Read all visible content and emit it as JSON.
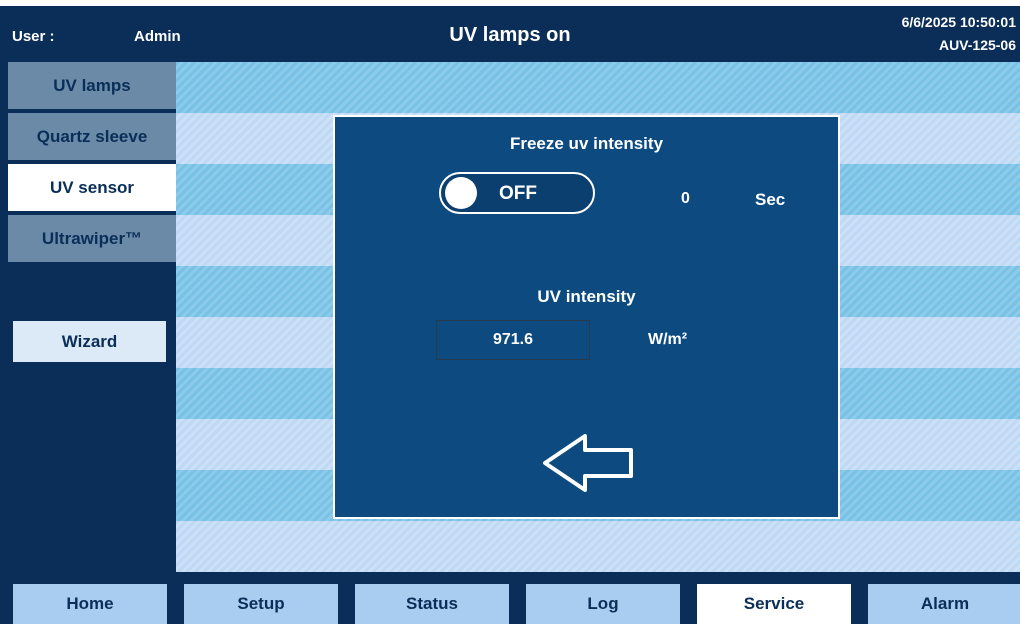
{
  "header": {
    "user_label": "User :",
    "user_value": "Admin",
    "title": "UV lamps on",
    "datetime": "6/6/2025 10:50:01",
    "device_id": "AUV-125-06"
  },
  "sidebar": {
    "items": [
      {
        "label": "UV lamps",
        "active": false
      },
      {
        "label": "Quartz sleeve",
        "active": false
      },
      {
        "label": "UV sensor",
        "active": true
      },
      {
        "label": "Ultrawiper™",
        "active": false
      }
    ],
    "wizard_label": "Wizard"
  },
  "dialog": {
    "freeze_title": "Freeze uv intensity",
    "toggle_label": "OFF",
    "freeze_seconds": "0",
    "seconds_unit": "Sec",
    "intensity_label": "UV intensity",
    "intensity_value": "971.6",
    "intensity_unit": "W/m²",
    "back_icon": "back-arrow-icon"
  },
  "bottom_nav": [
    {
      "label": "Home",
      "active": false
    },
    {
      "label": "Setup",
      "active": false
    },
    {
      "label": "Status",
      "active": false
    },
    {
      "label": "Log",
      "active": false
    },
    {
      "label": "Service",
      "active": true
    },
    {
      "label": "Alarm",
      "active": false
    }
  ],
  "colors": {
    "navy": "#0a2e57",
    "dialog_blue": "#0c4a80",
    "nav_button": "#a9cdf1",
    "inactive_side": "#6a8aa8"
  }
}
